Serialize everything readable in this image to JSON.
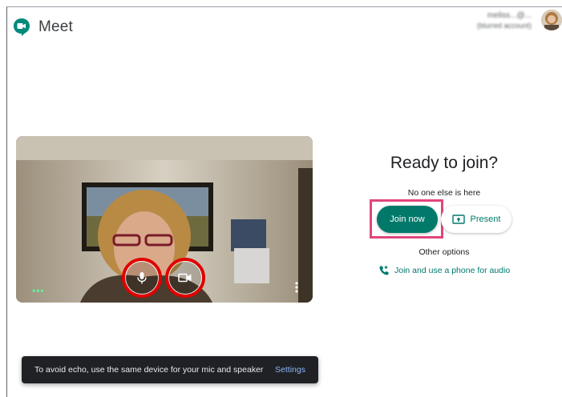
{
  "app": {
    "name": "Meet"
  },
  "account": {
    "email": "meliss...@...",
    "label": "(blurred account)"
  },
  "preview": {
    "mic_state": "on",
    "camera_state": "on"
  },
  "join": {
    "title": "Ready to join?",
    "status": "No one else is here",
    "join_label": "Join now",
    "present_label": "Present",
    "other_options": "Other options",
    "phone_label": "Join and use a phone for audio"
  },
  "toast": {
    "message": "To avoid echo, use the same device for your mic and speaker",
    "action": "Settings"
  },
  "colors": {
    "accent": "#00796b",
    "highlight_red": "#e00000",
    "highlight_pink": "#e0457b"
  }
}
